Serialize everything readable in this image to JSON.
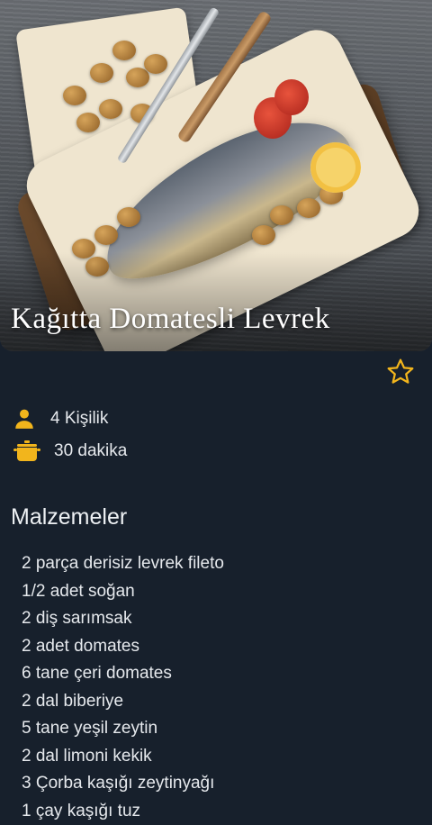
{
  "recipe": {
    "title": "Kağıtta Domatesli Levrek",
    "servings": "4 Kişilik",
    "duration": "30 dakika"
  },
  "icons": {
    "favorite": "star-outline-icon",
    "servings": "person-icon",
    "duration": "cooking-pot-icon"
  },
  "colors": {
    "background": "#17202c",
    "accent": "#f2b51c",
    "text": "#e6e9ed"
  },
  "ingredients_section": {
    "title": "Malzemeler",
    "items": [
      "2 parça derisiz levrek fileto",
      "1/2 adet soğan",
      "2 diş sarımsak",
      "2 adet domates",
      "6 tane çeri domates",
      "2 dal biberiye",
      "5 tane yeşil zeytin",
      "2 dal limoni kekik",
      "3 Çorba kaşığı zeytinyağı",
      "1 çay kaşığı tuz"
    ]
  }
}
